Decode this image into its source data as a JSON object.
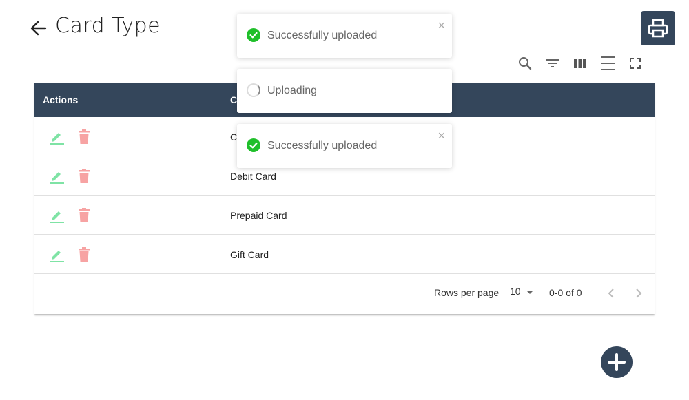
{
  "header": {
    "title": "Card Type",
    "back_icon": "arrow-left-icon",
    "print_icon": "printer-icon"
  },
  "toolbar": {
    "icons": [
      "search-icon",
      "filter-icon",
      "view-columns-icon",
      "density-icon",
      "fullscreen-icon"
    ]
  },
  "table": {
    "columns": [
      "Actions",
      "C"
    ],
    "rows": [
      {
        "name": "C"
      },
      {
        "name": "Debit Card"
      },
      {
        "name": "Prepaid Card"
      },
      {
        "name": "Gift Card"
      }
    ]
  },
  "pagination": {
    "rows_per_page_label": "Rows per page",
    "rows_per_page_value": "10",
    "range": "0-0 of 0"
  },
  "toasts": [
    {
      "status": "success",
      "text": "Successfully uploaded",
      "close": "×"
    },
    {
      "status": "loading",
      "text": "Uploading",
      "close": ""
    },
    {
      "status": "success",
      "text": "Successfully uploaded",
      "close": "×"
    }
  ],
  "colors": {
    "header_bg": "#34465b",
    "edit": "#7fe3a5",
    "delete": "#f7a3a3",
    "success": "#1fbf2a"
  }
}
